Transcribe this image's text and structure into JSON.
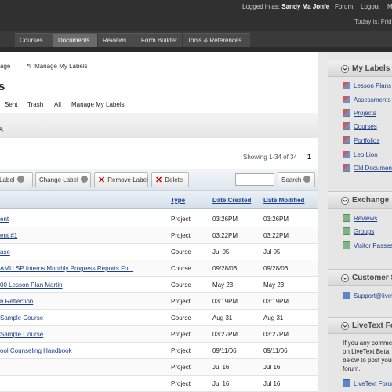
{
  "topbar": {
    "logged_in_prefix": "Logged in as: ",
    "user_name": "Sandy Ma Jonfe",
    "forum": "Forum",
    "logout": "Logout",
    "more": "M",
    "today": "Today is: Frida"
  },
  "nav": {
    "tabs": [
      "Courses",
      "Documents",
      "Reviews",
      "Form Builder",
      "Tools & References"
    ],
    "active": "Documents"
  },
  "breadcrumb": {
    "first": "age",
    "second": "Manage My Labels"
  },
  "page": {
    "title": "s",
    "band_letter": "s"
  },
  "subtabs": [
    "Sent",
    "Trash",
    "All",
    "Manage My Labels"
  ],
  "paging": {
    "showing": "Showing 1-34 of 34",
    "page": "1"
  },
  "toolbar": {
    "label_btn": "Label",
    "change_label_btn": "Change Label",
    "remove_label_btn": "Remove Label",
    "delete_btn": "Delete",
    "search_btn": "Search",
    "search_value": ""
  },
  "table": {
    "headers": {
      "type": "Type",
      "created": "Date Created",
      "modified": "Date Modified"
    },
    "rows": [
      {
        "name": "ent",
        "type": "Project",
        "created": "03:26PM",
        "modified": "03:26PM"
      },
      {
        "name": "ent #1",
        "type": "Project",
        "created": "03:22PM",
        "modified": "03:22PM"
      },
      {
        "name": "ase",
        "type": "Course",
        "created": "Jul 05",
        "modified": "Jul 05"
      },
      {
        "name": "AMU SP Interns Monthly Progress Reports Fo...",
        "type": "Course",
        "created": "09/28/06",
        "modified": "09/28/06"
      },
      {
        "name": "00 Lesson Plan Martin",
        "type": "Course",
        "created": "May 23",
        "modified": "May 23"
      },
      {
        "name": "n Reflection",
        "type": "Project",
        "created": "03:19PM",
        "modified": "03:19PM"
      },
      {
        "name": "Sample Course",
        "type": "Course",
        "created": "Aug 31",
        "modified": "Aug 31"
      },
      {
        "name": "Sample Course",
        "type": "Project",
        "created": "03:27PM",
        "modified": "03:27PM"
      },
      {
        "name": "ool Counseling Handbook",
        "type": "Project",
        "created": "09/11/06",
        "modified": "09/11/06"
      },
      {
        "name": "",
        "type": "Project",
        "created": "Jul 16",
        "modified": "Jul 16"
      },
      {
        "name": "",
        "type": "Project",
        "created": "Jul 16",
        "modified": "Jul 16"
      }
    ]
  },
  "sidebar": {
    "my_labels": {
      "title": "My Labels",
      "items": [
        "Lesson Plans",
        "Assessments",
        "Projects",
        "Courses",
        "Portfolios",
        "Leo Lion",
        "Old Documents"
      ]
    },
    "exchange": {
      "title": "Exchange",
      "items": [
        "Reviews",
        "Groups",
        "Visitor Passes"
      ]
    },
    "customer_service": {
      "title": "Customer Se",
      "link": "Support@livetex"
    },
    "forum": {
      "title": "LiveText Foru",
      "lines": [
        "If you any comments",
        "on LiveText Beta, pl",
        "below to post your f",
        "forum."
      ],
      "link": "LiveText Forum"
    }
  }
}
